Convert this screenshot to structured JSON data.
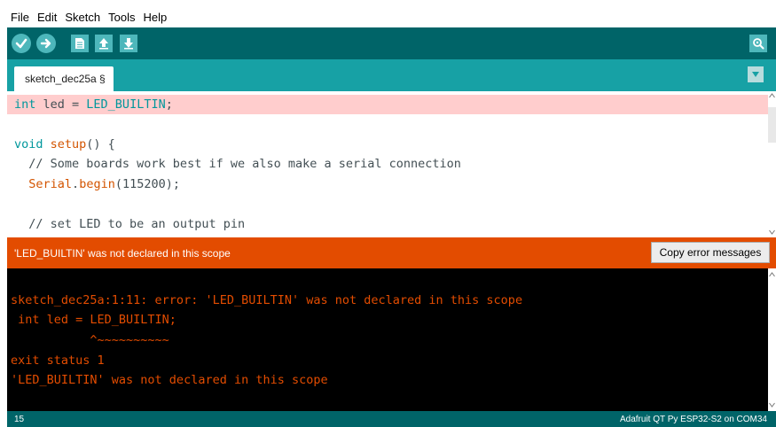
{
  "menu": {
    "items": [
      "File",
      "Edit",
      "Sketch",
      "Tools",
      "Help"
    ]
  },
  "toolbar": {
    "icons": [
      "verify-icon",
      "upload-icon",
      "new-icon",
      "open-icon",
      "save-icon",
      "serial-monitor-icon"
    ]
  },
  "tabs": {
    "active_label": "sketch_dec25a §"
  },
  "editor": {
    "lines": [
      {
        "type": "int",
        "name": " led = ",
        "value": "LED_BUILTIN",
        "end": ";"
      },
      {
        "text": ""
      },
      {
        "kw": "void",
        "fn": " setup",
        "rest": "() {"
      },
      {
        "text": "  // Some boards work best if we also make a serial connection"
      },
      {
        "obj": "Serial",
        "dot": ".",
        "method": "begin",
        "args": "(115200);"
      },
      {
        "text": ""
      },
      {
        "text": "  // set LED to be an output pin"
      }
    ]
  },
  "error": {
    "message": "'LED_BUILTIN' was not declared in this scope",
    "copy_label": "Copy error messages"
  },
  "console": {
    "lines": [
      "sketch_dec25a:1:11: error: 'LED_BUILTIN' was not declared in this scope",
      " int led = LED_BUILTIN;",
      "           ^~~~~~~~~~~",
      "exit status 1",
      "'LED_BUILTIN' was not declared in this scope"
    ]
  },
  "status": {
    "line_number": "15",
    "board": "Adafruit QT Py ESP32-S2 on COM34"
  },
  "colors": {
    "toolbar_bg": "#006468",
    "tabbar_bg": "#17a1a5",
    "error_bar": "#e34c00",
    "highlight_line": "#ffcdcd",
    "console_text": "#e34c00"
  }
}
